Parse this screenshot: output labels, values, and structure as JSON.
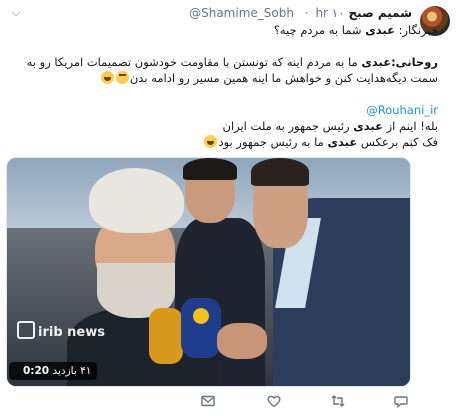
{
  "tweet": {
    "author_name": "شمیم صبح",
    "author_handle": "@Shamime_Sobh",
    "time": "hr ۱۰",
    "lines": {
      "l1a": "خبرنگار: ",
      "l1b": "عبدی",
      "l1c": " شما به مردم چیه؟",
      "l2a": "روحانی:",
      "l2b": "عبدی",
      "l2c": " ما به مردم اینه که تونستن با مقاومت خودشون تصمیمات امریکا رو به سمت دیگه‌هدایت کنن و خواهش ما اینه همین مسیر رو ادامه بدن",
      "mention": "@Rouhani_ir",
      "l3": "بله! اینم از ",
      "l3b": "عبدی",
      "l3c": " رئیس جمهور به ملت ایران",
      "l4": "فک کنم برعکس ",
      "l4b": "عبدی",
      "l4c": " ما به رئیس جمهور بود"
    }
  },
  "video": {
    "channel_logo": "irib news",
    "duration": "0:20",
    "views": "۴۱ بازدید"
  },
  "icons": {
    "reply": "reply-icon",
    "retweet": "retweet-icon",
    "like": "heart-icon",
    "dm": "mail-icon",
    "more": "chevron-down-icon"
  }
}
